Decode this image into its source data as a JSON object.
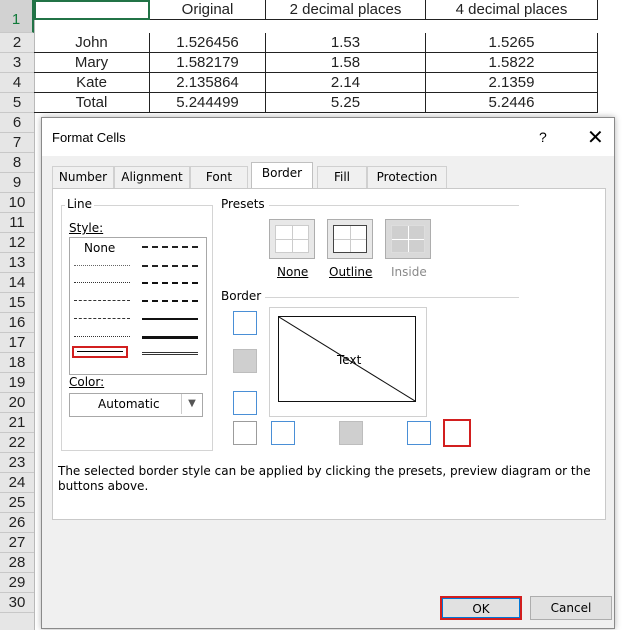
{
  "spreadsheet": {
    "row_numbers": [
      "1",
      "2",
      "3",
      "4",
      "5",
      "6",
      "7",
      "8",
      "9",
      "10",
      "11",
      "12",
      "13",
      "14",
      "15",
      "16",
      "17",
      "18",
      "19",
      "20",
      "21",
      "22",
      "23",
      "24",
      "25",
      "26",
      "27",
      "28",
      "29",
      "30"
    ],
    "header": [
      "",
      "Original",
      "2 decimal places",
      "4 decimal places"
    ],
    "rows": [
      [
        "John",
        "1.526456",
        "1.53",
        "1.5265"
      ],
      [
        "Mary",
        "1.582179",
        "1.58",
        "1.5822"
      ],
      [
        "Kate",
        "2.135864",
        "2.14",
        "2.1359"
      ],
      [
        "Total",
        "5.244499",
        "5.25",
        "5.2446"
      ]
    ]
  },
  "dialog": {
    "title": "Format Cells",
    "help": "?",
    "close": "✕",
    "tabs": [
      "Number",
      "Alignment",
      "Font",
      "Border",
      "Fill",
      "Protection"
    ],
    "active_tab": "Border",
    "line_group": "Line",
    "style_label": "Style:",
    "style_none": "None",
    "color_label": "Color:",
    "color_value": "Automatic",
    "presets_group": "Presets",
    "preset_labels": [
      "None",
      "Outline",
      "Inside"
    ],
    "border_group": "Border",
    "preview_text": "Text",
    "hint": "The selected border style can be applied by clicking the presets, preview diagram or the buttons above.",
    "ok": "OK",
    "cancel": "Cancel"
  },
  "colors": {
    "highlight": "#d21f1f",
    "accent_blue": "#4a8fd6",
    "excel_green": "#217346"
  }
}
